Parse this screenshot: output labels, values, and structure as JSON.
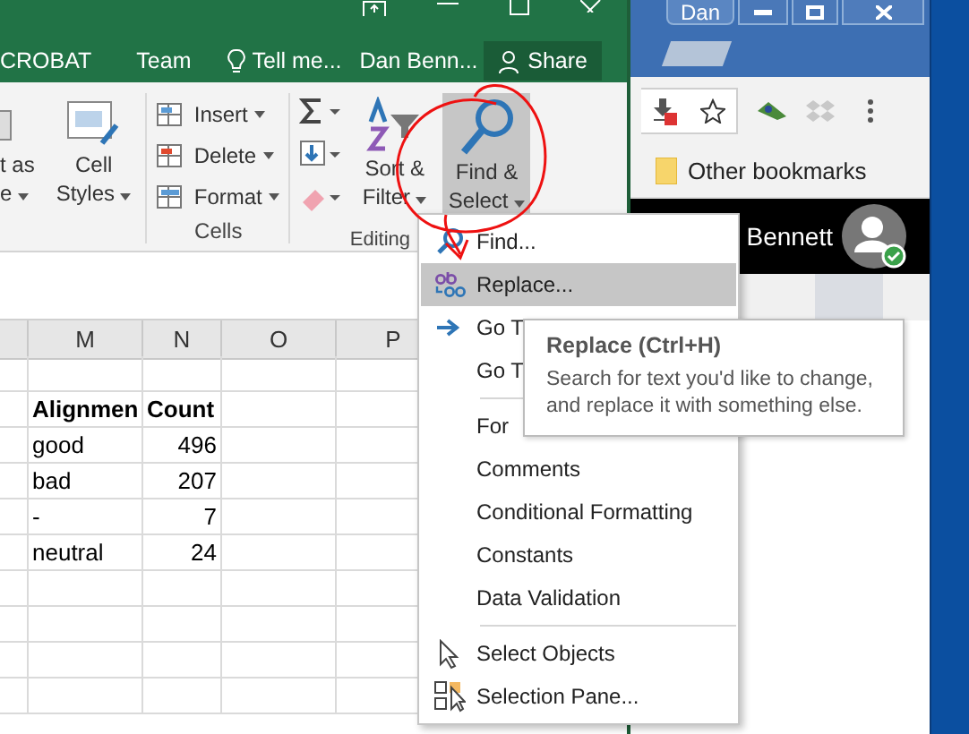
{
  "excel": {
    "tabs": [
      {
        "label": "CROBAT",
        "selected": false
      },
      {
        "label": "Team",
        "selected": false
      }
    ],
    "tell_me": "Tell me...",
    "user": "Dan Benn...",
    "share": "Share",
    "ribbon": {
      "format_table_lines": [
        "t as",
        "e"
      ],
      "cell_styles_lines": [
        "Cell",
        "Styles"
      ],
      "cells": {
        "commands": [
          "Insert",
          "Delete",
          "Format"
        ],
        "label": "Cells"
      },
      "editing": {
        "sort_filter_lines": [
          "Sort &",
          "Filter"
        ],
        "find_select": {
          "lines": [
            "Find &",
            "Select"
          ],
          "selected": true
        },
        "label": "Editing"
      }
    },
    "grid": {
      "columns": [
        "M",
        "N",
        "O",
        "P"
      ],
      "rows": [
        {
          "bold": true,
          "cells": [
            "Alignmen",
            "Count"
          ]
        },
        {
          "bold": false,
          "cells": [
            "good",
            "496"
          ]
        },
        {
          "bold": false,
          "cells": [
            "bad",
            "207"
          ]
        },
        {
          "bold": false,
          "cells": [
            "-",
            "7"
          ]
        },
        {
          "bold": false,
          "cells": [
            "neutral",
            "24"
          ]
        }
      ]
    }
  },
  "chrome": {
    "profile": "Dan",
    "bookmarks": "Other bookmarks",
    "account": "Bennett"
  },
  "menu": {
    "sections": [
      [
        {
          "label": "Find...",
          "kind": "find",
          "selected": false
        },
        {
          "label": "Replace...",
          "kind": "replace",
          "selected": true
        },
        {
          "label": "Go T",
          "kind": "goto",
          "selected": false
        },
        {
          "label": "Go T",
          "kind": "plain",
          "selected": false
        }
      ],
      [
        {
          "label": "For",
          "kind": "plain",
          "selected": false
        },
        {
          "label": "Comments",
          "kind": "plain",
          "selected": false
        },
        {
          "label": "Conditional Formatting",
          "kind": "plain",
          "selected": false
        },
        {
          "label": "Constants",
          "kind": "plain",
          "selected": false
        },
        {
          "label": "Data Validation",
          "kind": "plain",
          "selected": false
        }
      ],
      [
        {
          "label": "Select Objects",
          "kind": "pointer",
          "selected": false
        },
        {
          "label": "Selection Pane...",
          "kind": "pane",
          "selected": false
        }
      ]
    ]
  },
  "tooltip": {
    "title": "Replace (Ctrl+H)",
    "text": "Search for text you'd like to change, and replace it with something else."
  }
}
